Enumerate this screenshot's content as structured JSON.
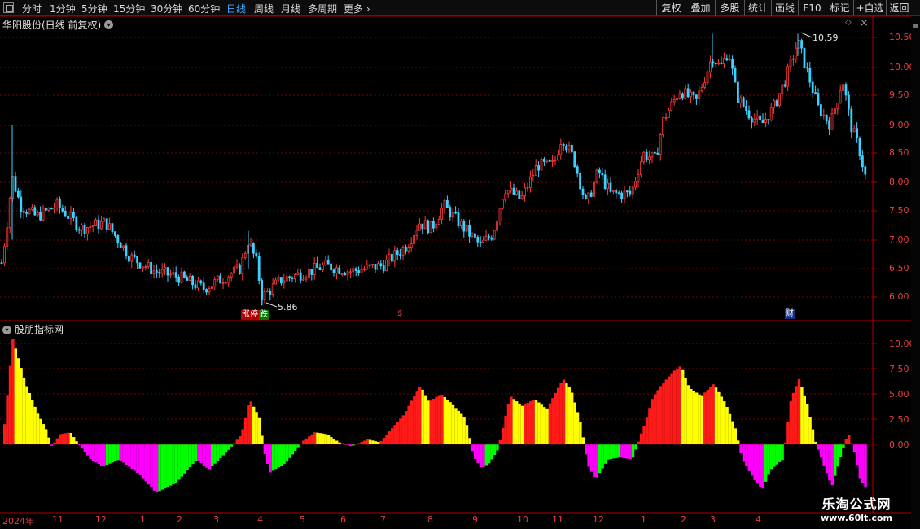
{
  "toolbar": {
    "periods": [
      "分时",
      "1分钟",
      "5分钟",
      "15分钟",
      "30分钟",
      "60分钟",
      "日线",
      "周线",
      "月线",
      "多周期",
      "更多"
    ],
    "active_period": "日线",
    "more_arrow": "›",
    "right_buttons": [
      "复权",
      "叠加",
      "多股",
      "统计",
      "画线",
      "F10",
      "标记",
      "+自选",
      "返回"
    ]
  },
  "main_chart": {
    "title": "华阳股份(日线 前复权)",
    "high_marker": "10.59",
    "low_marker": "5.86",
    "price_labels": [
      "10.50",
      "10.00",
      "9.50",
      "9.00",
      "8.50",
      "8.00",
      "7.50",
      "7.00",
      "6.50",
      "6.00"
    ]
  },
  "indicator": {
    "title": "股朋指标网",
    "labels": [
      "10.00",
      "7.50",
      "5.00",
      "2.50",
      "0.00"
    ]
  },
  "date_axis": {
    "labels": [
      "2024年",
      "11",
      "12",
      "1",
      "2",
      "3",
      "4",
      "5",
      "6",
      "7",
      "8",
      "9",
      "10",
      "11",
      "12",
      "1",
      "2",
      "3",
      "4"
    ]
  },
  "event_tags": {
    "zhangting": "涨",
    "zhangting2": "停",
    "die": "跌",
    "s": "$",
    "cai": "财"
  },
  "watermark": {
    "title": "乐淘公式网",
    "url": "www.60lt.com"
  },
  "colors": {
    "up": "#ff3b3b",
    "down": "#3cd1ff",
    "grid": "#7a0000",
    "bar_red": "#ff1a1a",
    "bar_yellow": "#ffff00",
    "bar_magenta": "#ff00ff",
    "bar_green": "#00ff00"
  }
}
